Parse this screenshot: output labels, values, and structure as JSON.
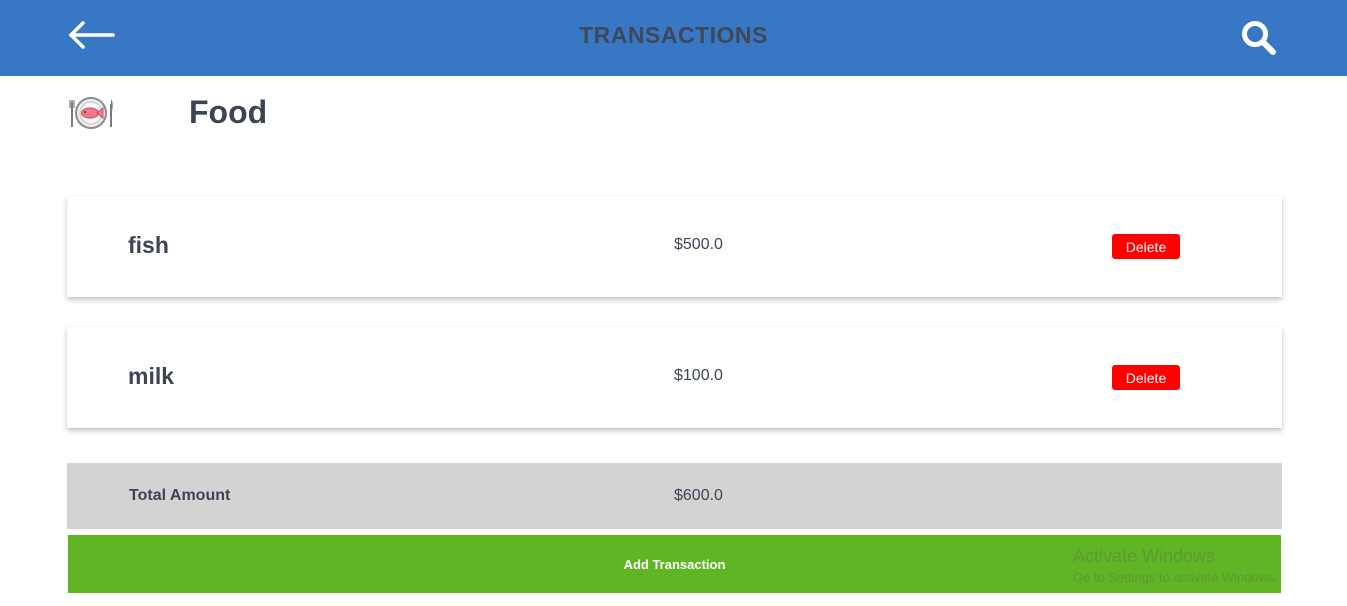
{
  "header": {
    "title": "TRANSACTIONS",
    "back_icon": "arrow-left-icon",
    "search_icon": "search-icon",
    "bg_color": "#3777c4"
  },
  "category": {
    "name": "Food",
    "icon": "food-plate-icon"
  },
  "transactions": [
    {
      "name": "fish",
      "amount": "$500.0",
      "delete_label": "Delete"
    },
    {
      "name": "milk",
      "amount": "$100.0",
      "delete_label": "Delete"
    }
  ],
  "total": {
    "label": "Total Amount",
    "value": "$600.0"
  },
  "add_button": {
    "label": "Add Transaction",
    "color": "#5fb524"
  },
  "delete_color": "#ff0000",
  "watermark": {
    "title": "Activate Windows",
    "subtitle": "Go to Settings to activate Windows."
  }
}
